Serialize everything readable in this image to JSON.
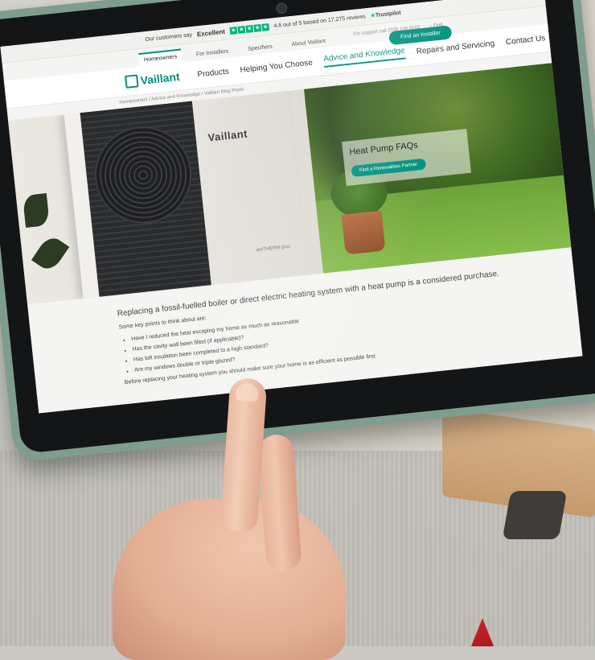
{
  "site": {
    "topbar": {
      "prefix": "Our customers say",
      "rating_word": "Excellent",
      "stars": [
        "★",
        "★",
        "★",
        "★",
        "★"
      ],
      "review_summary": "4.6 out of 5 based on 17,275 reviews",
      "trustpilot": "Trustpilot"
    },
    "utility": {
      "support": "For support call 0330 100 3143",
      "find": "Find"
    },
    "audience_tabs": [
      "Homeowners",
      "For Installers",
      "Specifiers",
      "About Vaillant"
    ],
    "find_installer": "Find an Installer",
    "logo": "Vaillant",
    "nav": [
      "Products",
      "Helping You Choose",
      "Advice and Knowledge",
      "Repairs and Servicing",
      "Contact Us"
    ],
    "breadcrumb": "Homeowners / Advice and Knowledge / Vaillant Blog Posts",
    "hero": {
      "brand_on_unit": "Vaillant",
      "unit_model": "aroTHERM plus",
      "card_title": "Heat Pump FAQs",
      "card_button": "Find a Renewables Partner"
    },
    "content": {
      "intro": "Replacing a fossil-fuelled boiler or direct electric heating system with a heat pump is a considered purchase.",
      "lead": "Some key points to think about are:",
      "bullets": [
        "Have I reduced the heat escaping my home as much as reasonable",
        "Has the cavity wall been filled (if applicable)?",
        "Has loft insulation been completed to a high standard?",
        "Are my windows double or triple glazed?"
      ],
      "closing": "Before replacing your heating system you should make sure your home is as efficient as possible first."
    }
  },
  "colors": {
    "brand": "#00917e",
    "trustpilot_green": "#00b67a",
    "tablet_case": "#7f9d8e"
  }
}
